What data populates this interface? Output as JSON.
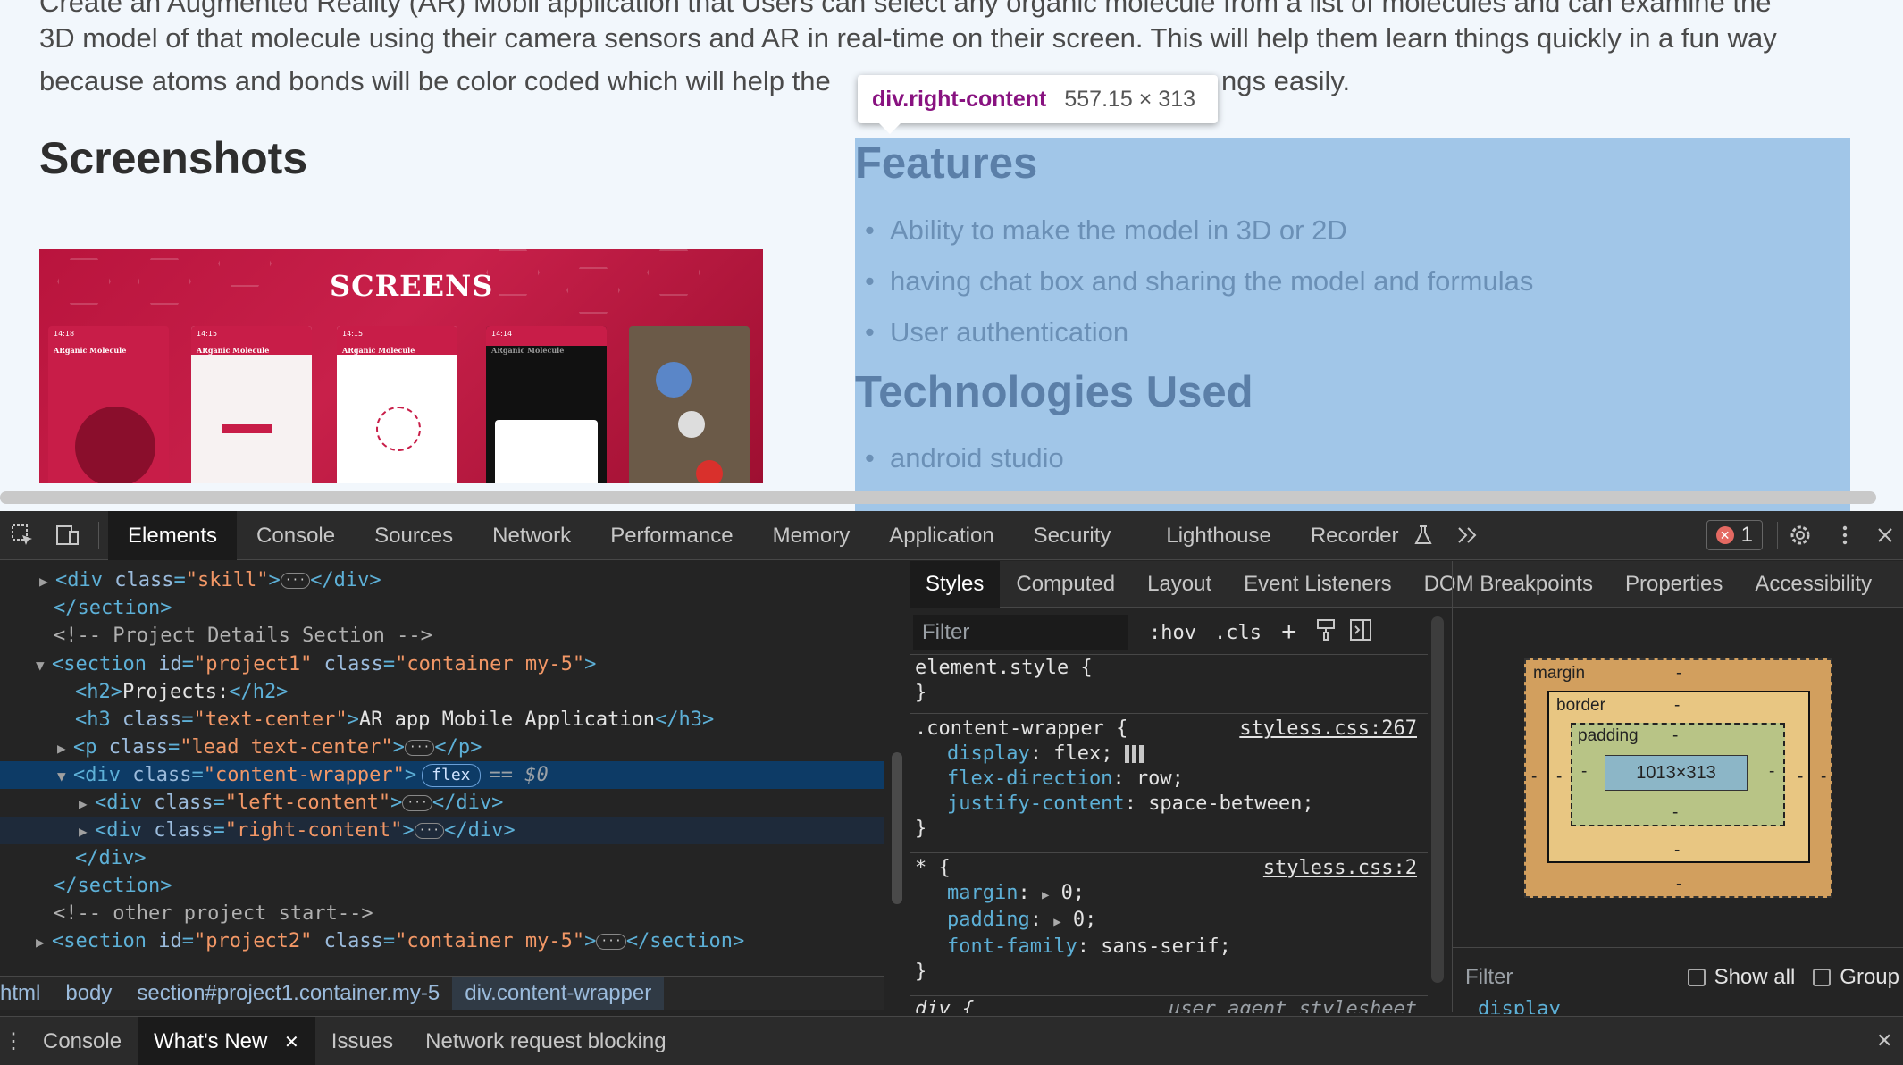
{
  "page": {
    "para_line1": "Create an Augmented Reality (AR) Mobil application that Users can select any organic molecule from a list of molecules and can examine the",
    "para_line2": "3D model of that molecule using their camera sensors and AR in real-time on their screen. This will help them learn things quickly in a fun way",
    "para_line3": "because atoms and bonds will be color coded which will help the",
    "para_line3_end": "ngs easily.",
    "screenshots_heading": "Screenshots",
    "screens_title": "SCREENS",
    "phone_app_name": "ARganic Molecule",
    "features_heading": "Features",
    "features": [
      "Ability to make the model in 3D or 2D",
      "having chat box and sharing the model and formulas",
      "User authentication"
    ],
    "tech_heading": "Technologies Used",
    "technologies": [
      "android studio"
    ]
  },
  "tooltip": {
    "selector": "div.right-content",
    "dimensions": "557.15 × 313"
  },
  "devtools": {
    "tabs": [
      "Elements",
      "Console",
      "Sources",
      "Network",
      "Performance",
      "Memory",
      "Application",
      "Security",
      "Lighthouse",
      "Recorder"
    ],
    "error_count": "1",
    "dom": {
      "l1_tag": "div",
      "l1_attr": "class",
      "l1_val": "\"skill\"",
      "l2": "</section>",
      "l3": "<!-- Project Details Section -->",
      "l4_attr1": "id",
      "l4_val1": "\"project1\"",
      "l4_attr2": "class",
      "l4_val2": "\"container my-5\"",
      "l5_text": "Projects:",
      "l6_attr": "class",
      "l6_val": "\"text-center\"",
      "l6_text": "AR app Mobile Application",
      "l7_attr": "class",
      "l7_val": "\"lead text-center\"",
      "l8_attr": "class",
      "l8_val": "\"content-wrapper\"",
      "l8_badge": "flex",
      "l8_dollar": "== $0",
      "l9_attr": "class",
      "l9_val": "\"left-content\"",
      "l10_attr": "class",
      "l10_val": "\"right-content\"",
      "l11": "</div>",
      "l12": "</section>",
      "l13": "<!-- other project start-->",
      "l14_attr1": "id",
      "l14_val1": "\"project2\"",
      "l14_attr2": "class",
      "l14_val2": "\"container my-5\""
    },
    "breadcrumbs": [
      "html",
      "body",
      "section#project1.container.my-5",
      "div.content-wrapper"
    ],
    "sub_tabs": [
      "Styles",
      "Computed",
      "Layout",
      "Event Listeners",
      "DOM Breakpoints",
      "Properties",
      "Accessibility"
    ],
    "filter_placeholder": "Filter",
    "hov": ":hov",
    "cls": ".cls",
    "rules": {
      "element_style": "element.style {",
      "wrapper_selector": ".content-wrapper {",
      "wrapper_src": "styless.css:267",
      "display": "display",
      "display_val": "flex;",
      "flexdir": "flex-direction",
      "flexdir_val": "row;",
      "justify": "justify-content",
      "justify_val": "space-between;",
      "star_selector": "* {",
      "star_src": "styless.css:2",
      "margin": "margin",
      "margin_val": "0;",
      "padding": "padding",
      "padding_val": "0;",
      "font": "font-family",
      "font_val": "sans-serif;",
      "div_selector": "div {",
      "div_src": "user agent stylesheet",
      "close": "}"
    },
    "boxmodel": {
      "margin": "margin",
      "border": "border",
      "padding": "padding",
      "content": "1013×313",
      "dash": "-"
    },
    "computed_filter": "Filter",
    "show_all": "Show all",
    "group": "Group",
    "computed_first": "display",
    "drawer_tabs": [
      "Console",
      "What's New",
      "Issues",
      "Network request blocking"
    ]
  }
}
